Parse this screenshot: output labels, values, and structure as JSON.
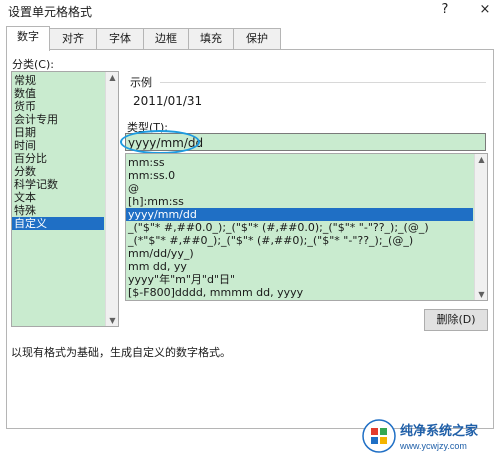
{
  "window": {
    "title": "设置单元格格式",
    "help_label": "?",
    "close_label": "×"
  },
  "tabs": [
    {
      "label": "数字",
      "active": true
    },
    {
      "label": "对齐",
      "active": false
    },
    {
      "label": "字体",
      "active": false
    },
    {
      "label": "边框",
      "active": false
    },
    {
      "label": "填充",
      "active": false
    },
    {
      "label": "保护",
      "active": false
    }
  ],
  "category": {
    "label": "分类(C):",
    "items": [
      "常规",
      "数值",
      "货币",
      "会计专用",
      "日期",
      "时间",
      "百分比",
      "分数",
      "科学记数",
      "文本",
      "特殊",
      "自定义"
    ],
    "selected": "自定义"
  },
  "sample": {
    "label": "示例",
    "value": "2011/01/31"
  },
  "type": {
    "label": "类型(T):",
    "value": "yyyy/mm/dd",
    "options": [
      "mm:ss",
      "mm:ss.0",
      "@",
      "[h]:mm:ss",
      "yyyy/mm/dd",
      "_(\"$\"* #,##0.0_);_(\"$\"* (#,##0.0);_(\"$\"* \"-\"??_);_(@_)",
      "_(*\"$\"* #,##0_);_(\"$\"* (#,##0);_(\"$\"* \"-\"??_);_(@_)",
      "mm/dd/yy_)",
      "mm dd, yy",
      "yyyy\"年\"m\"月\"d\"日\"",
      "[$-F800]dddd, mmmm dd, yyyy"
    ],
    "selected": "yyyy/mm/dd"
  },
  "delete_button": "删除(D)",
  "description": "以现有格式为基础，生成自定义的数字格式。",
  "colors": {
    "highlight": "#1f6fc5",
    "list_bg": "#c9ebcf",
    "annotation": "#1d9be0",
    "arrow": "#e23b2e"
  },
  "watermark": {
    "name": "纯净系统之家",
    "url": "www.ycwjzy.com"
  }
}
